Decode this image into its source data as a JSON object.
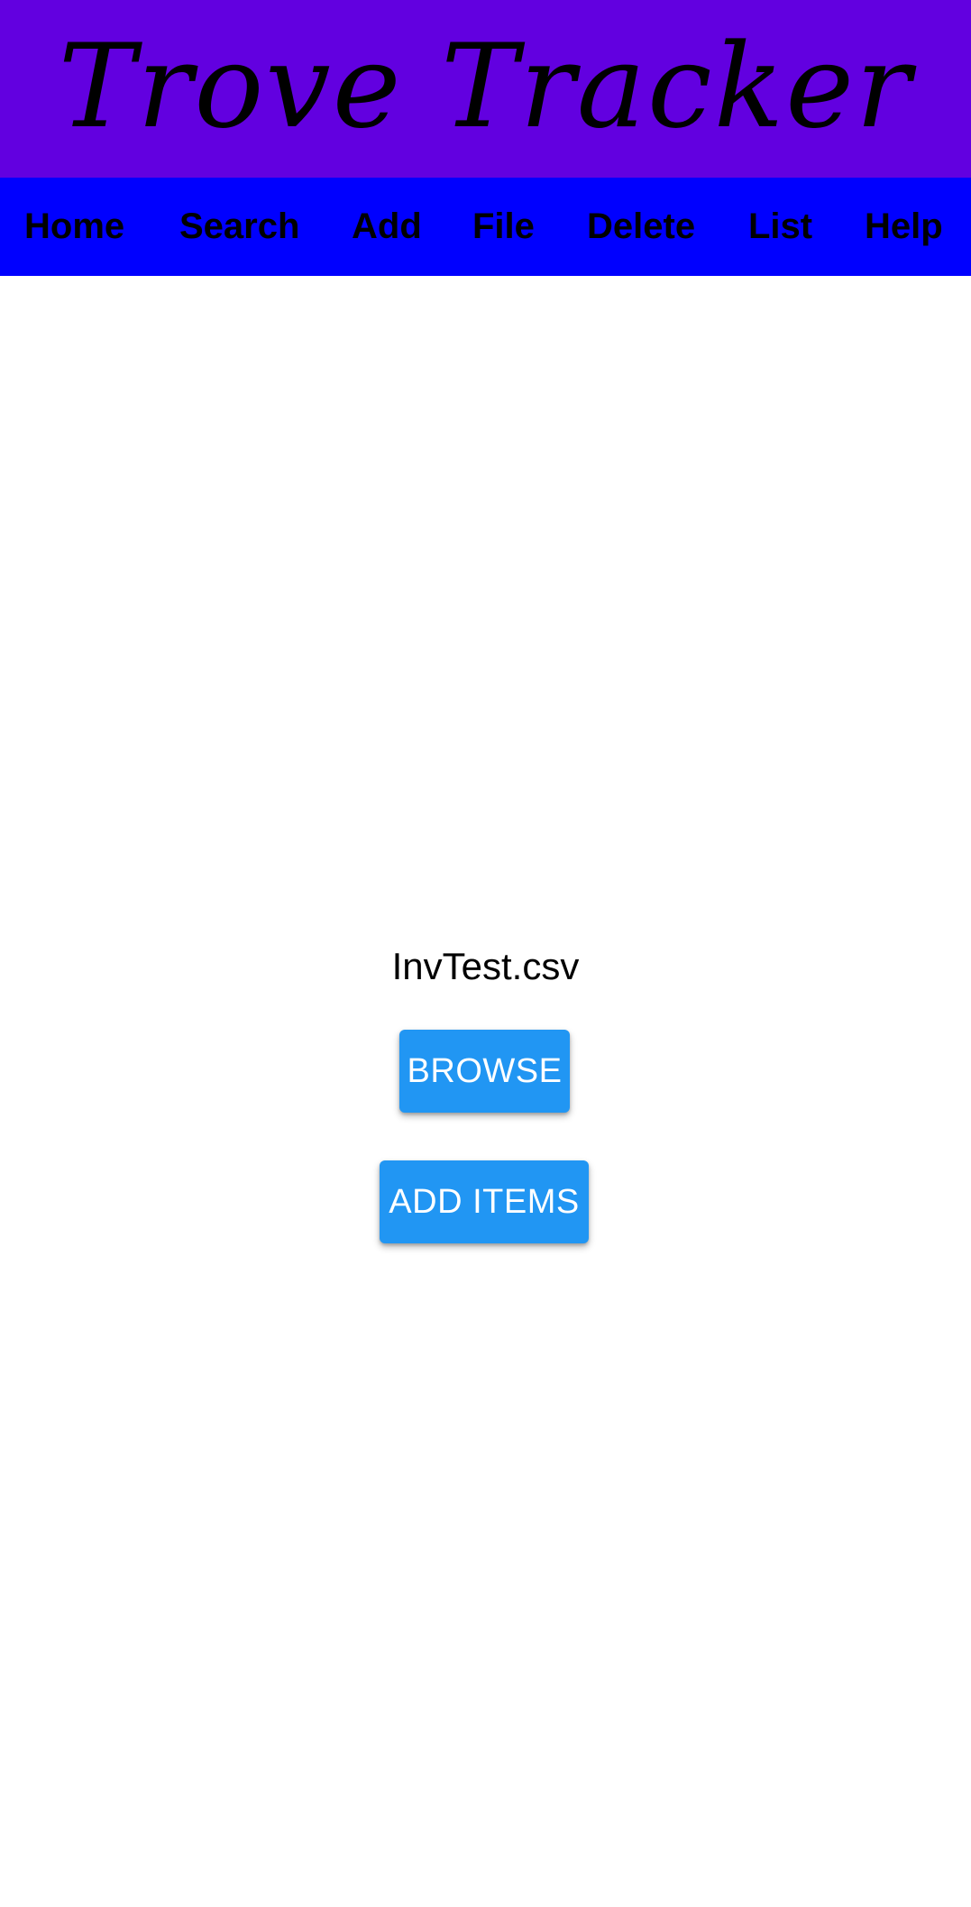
{
  "header": {
    "title": "Trove Tracker",
    "background": "#6200e0"
  },
  "nav": {
    "background": "#0000ff",
    "items": [
      {
        "label": "Home"
      },
      {
        "label": "Search"
      },
      {
        "label": "Add"
      },
      {
        "label": "File"
      },
      {
        "label": "Delete"
      },
      {
        "label": "List"
      },
      {
        "label": "Help"
      }
    ]
  },
  "main": {
    "file_name": "InvTest.csv",
    "browse_label": "BROWSE",
    "add_items_label": "ADD ITEMS",
    "button_color": "#2196f3"
  }
}
